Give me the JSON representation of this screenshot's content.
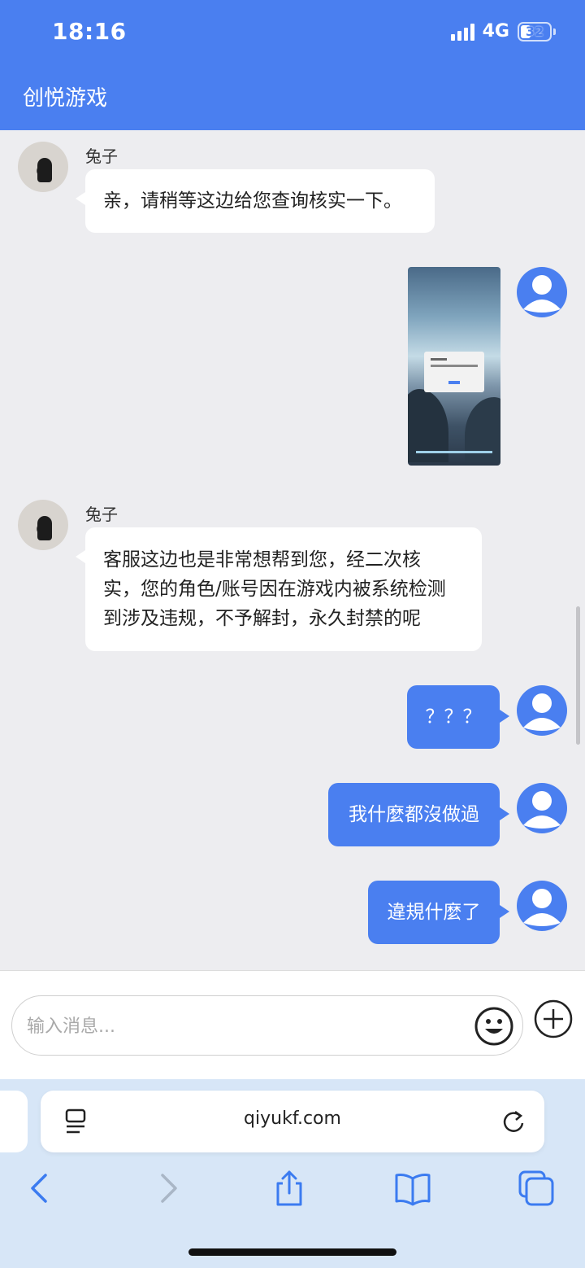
{
  "status_bar": {
    "time": "18:16",
    "network": "4G",
    "battery": "32"
  },
  "header": {
    "title": "创悦游戏"
  },
  "messages": [
    {
      "side": "in",
      "sender": "兔子",
      "text": "亲，请稍等这边给您查询核实一下。"
    },
    {
      "side": "out",
      "type": "image"
    },
    {
      "side": "in",
      "sender": "兔子",
      "lines": [
        "客服这边也是非常想帮到您，经二次核",
        "实，您的角色/账号因在游戏内被系统检测",
        "到涉及违规，不予解封，永久封禁的呢"
      ]
    },
    {
      "side": "out",
      "text": "？？？"
    },
    {
      "side": "out",
      "text": "我什麼都沒做過"
    },
    {
      "side": "out",
      "text": "違規什麼了"
    }
  ],
  "input": {
    "placeholder": "输入消息...",
    "value": ""
  },
  "browser": {
    "url": "qiyukf.com"
  },
  "colors": {
    "accent": "#4a7ff0",
    "chat_bg": "#ededf0"
  },
  "icons": [
    "signal-icon",
    "battery-icon",
    "emoji-icon",
    "plus-icon",
    "reader-icon",
    "reload-icon",
    "back-icon",
    "forward-icon",
    "share-icon",
    "bookmarks-icon",
    "tabs-icon"
  ]
}
